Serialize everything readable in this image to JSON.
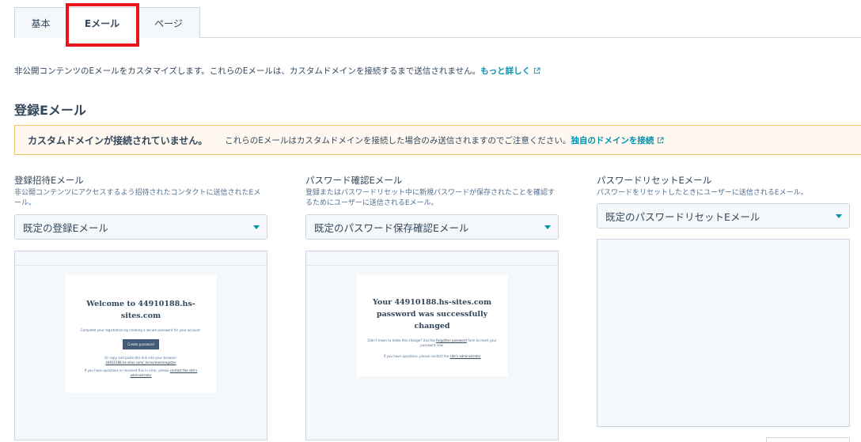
{
  "tabs": [
    {
      "label": "基本",
      "active": false
    },
    {
      "label": "Eメール",
      "active": true
    },
    {
      "label": "ページ",
      "active": false
    }
  ],
  "intro": {
    "text": "非公開コンテンツのEメールをカスタマイズします。これらのEメールは、カスタムドメインを接続するまで送信されません。",
    "link": "もっと詳しく"
  },
  "section_title": "登録Eメール",
  "alert": {
    "title": "カスタムドメインが接続されていません。",
    "text": "これらのEメールはカスタムドメインを接続した場合のみ送信されますのでご注意ください。",
    "link": "独自のドメインを接続"
  },
  "columns": [
    {
      "label": "登録招待Eメール",
      "help": "非公開コンテンツにアクセスするよう招待されたコンタクトに送信されたEメール。",
      "select": "既定の登録Eメール",
      "preview": {
        "title": "Welcome to 44910188.hs-sites.com",
        "line1": "Complete your registration by creating a secure password for your account.",
        "button": "Create password",
        "line2": "Or copy and paste this link into your browser:",
        "url": "44910188.hs-sites.com/_hcms/mem/register",
        "line3": "If you have questions or received this in error, please",
        "line3_link": "contact the site's administrator"
      }
    },
    {
      "label": "パスワード確認Eメール",
      "help": "登録またはパスワードリセット中に新規パスワードが保存されたことを確認するためにユーザーに送信されるEメール。",
      "select": "既定のパスワード保存確認Eメール",
      "preview": {
        "title": "Your 44910188.hs-sites.com password was successfully changed",
        "line1": "Didn't mean to make this change? Use the",
        "line1_link": "forgotten password",
        "line1_end": "form to reset your password now.",
        "line2": "If you have questions, please contact the",
        "line2_link": "site's administrator"
      }
    },
    {
      "label": "パスワードリセットEメール",
      "help": "パスワードをリセットしたときにユーザーに送信されるEメール。",
      "select": "既定のパスワードリセットEメール"
    }
  ],
  "colors": {
    "accent": "#0091ae",
    "highlight": "#e8131b",
    "alert_bg": "#fef8f0",
    "alert_border": "#f5c26b"
  },
  "icons": [
    "external-link-icon",
    "caret-down-icon"
  ]
}
